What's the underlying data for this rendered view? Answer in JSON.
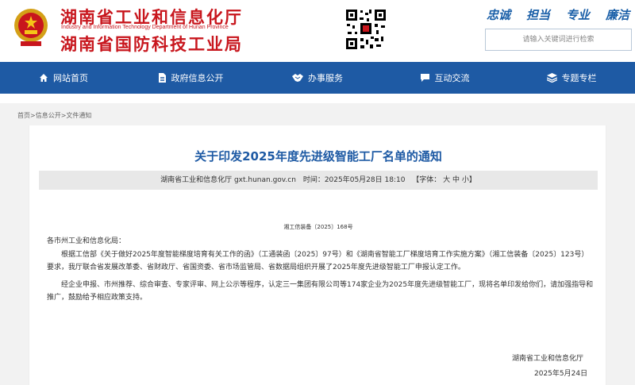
{
  "header": {
    "title_line1": "湖南省工业和信息化厅",
    "title_en": "Industry and Information Technology Department of Hunan Province",
    "title_line2": "湖南省国防科技工业局",
    "slogans": [
      "忠诚",
      "担当",
      "专业",
      "廉洁"
    ],
    "search_placeholder": "请输入关键词进行检索"
  },
  "nav": {
    "items": [
      {
        "label": "网站首页",
        "icon": "home-icon"
      },
      {
        "label": "政府信息公开",
        "icon": "document-icon"
      },
      {
        "label": "办事服务",
        "icon": "handshake-icon"
      },
      {
        "label": "互动交流",
        "icon": "chat-icon"
      },
      {
        "label": "专题专栏",
        "icon": "layers-icon"
      }
    ]
  },
  "breadcrumb": "首页>信息公开>文件通知",
  "article": {
    "title": "关于印发2025年度先进级智能工厂名单的通知",
    "source": "湖南省工业和信息化厅 gxt.hunan.gov.cn",
    "time": "时间：2025年05月28日 18:10",
    "font_size": "【字体： 大 中 小】",
    "doc_number": "湘工信装备〔2025〕168号",
    "salutation": "各市州工业和信息化局：",
    "para1": "根据工信部《关于做好2025年度智能梯度培育有关工作的函》（工通装函〔2025〕97号）和《湖南省智能工厂梯度培育工作实施方案》（湘工信装备〔2025〕123号）要求，我厅联合省发展改革委、省财政厅、省国资委、省市场监管局、省数据局组织开展了2025年度先进级智能工厂申报认定工作。",
    "para2": "经企业申报、市州推荐、综合审查、专家评审、网上公示等程序，认定三一集团有限公司等174家企业为2025年度先进级智能工厂，现将名单印发给你们，请加强指导和推广，鼓励给予相应政策支持。",
    "sign_org": "湖南省工业和信息化厅",
    "sign_date": "2025年5月24日"
  },
  "colors": {
    "brand_red": "#c8161d",
    "nav_blue": "#1e5aa4"
  }
}
